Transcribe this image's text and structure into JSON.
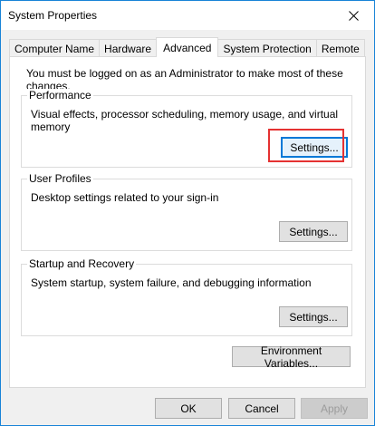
{
  "window": {
    "title": "System Properties"
  },
  "tabs": [
    {
      "label": "Computer Name"
    },
    {
      "label": "Hardware"
    },
    {
      "label": "Advanced",
      "active": true
    },
    {
      "label": "System Protection"
    },
    {
      "label": "Remote"
    }
  ],
  "advanced": {
    "admin_note": "You must be logged on as an Administrator to make most of these changes.",
    "performance": {
      "label": "Performance",
      "description": "Visual effects, processor scheduling, memory usage, and virtual memory",
      "button": "Settings..."
    },
    "user_profiles": {
      "label": "User Profiles",
      "description": "Desktop settings related to your sign-in",
      "button": "Settings..."
    },
    "startup_recovery": {
      "label": "Startup and Recovery",
      "description": "System startup, system failure, and debugging information",
      "button": "Settings..."
    },
    "env_button": "Environment Variables..."
  },
  "footer": {
    "ok": "OK",
    "cancel": "Cancel",
    "apply": "Apply"
  },
  "colors": {
    "highlight": "#e53232",
    "focus": "#0078d7",
    "window_border": "#1883d7"
  }
}
